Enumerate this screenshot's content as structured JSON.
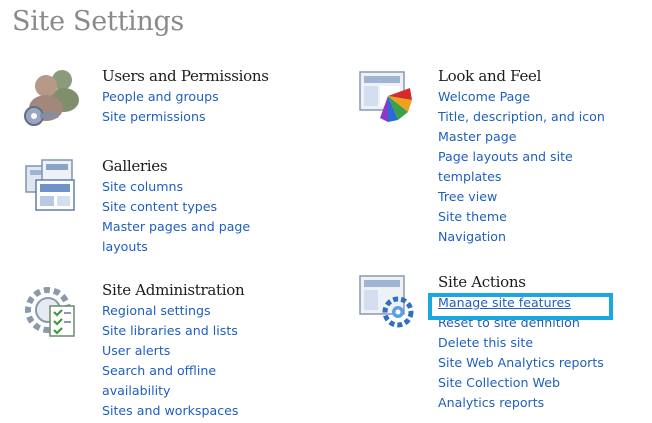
{
  "page": {
    "title": "Site Settings"
  },
  "sections": {
    "users_permissions": {
      "title": "Users and Permissions",
      "icon": "users-permissions-icon",
      "links": [
        "People and groups",
        "Site permissions"
      ]
    },
    "galleries": {
      "title": "Galleries",
      "icon": "galleries-icon",
      "links": [
        "Site columns",
        "Site content types",
        "Master pages and page layouts"
      ]
    },
    "site_administration": {
      "title": "Site Administration",
      "icon": "site-administration-icon",
      "links": [
        "Regional settings",
        "Site libraries and lists",
        "User alerts",
        "Search and offline availability",
        "Sites and workspaces"
      ]
    },
    "look_and_feel": {
      "title": "Look and Feel",
      "icon": "look-and-feel-icon",
      "links": [
        "Welcome Page",
        "Title, description, and icon",
        "Master page",
        "Page layouts and site templates",
        "Tree view",
        "Site theme",
        "Navigation"
      ]
    },
    "site_actions": {
      "title": "Site Actions",
      "icon": "site-actions-icon",
      "links": [
        "Manage site features",
        "Reset to site definition",
        "Delete this site",
        "Site Web Analytics reports",
        "Site Collection Web Analytics reports"
      ]
    }
  },
  "colors": {
    "link": "#1f5fbf",
    "highlight": "#1ba7e0",
    "title": "#8a8a8a"
  }
}
